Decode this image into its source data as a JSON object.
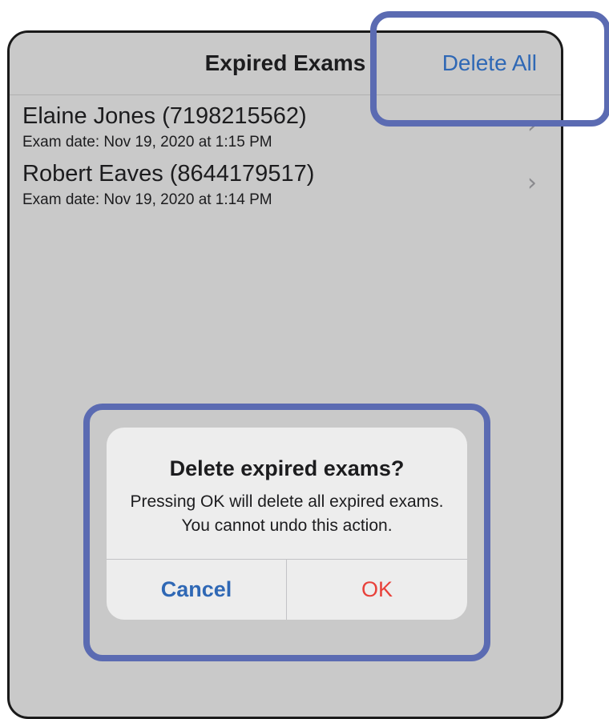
{
  "navbar": {
    "title": "Expired Exams",
    "action_label": "Delete All"
  },
  "exams": [
    {
      "name": "Elaine Jones (7198215562)",
      "date": "Exam date: Nov 19, 2020 at 1:15 PM"
    },
    {
      "name": "Robert Eaves (8644179517)",
      "date": "Exam date: Nov 19, 2020 at 1:14 PM"
    }
  ],
  "dialog": {
    "title": "Delete expired exams?",
    "message": "Pressing OK will delete all expired exams. You cannot undo this action.",
    "cancel_label": "Cancel",
    "ok_label": "OK"
  },
  "colors": {
    "accent": "#2f68b5",
    "destructive": "#e8413a",
    "highlight_border": "#5b6bb2",
    "screen_dimmed": "#c9c9c9"
  }
}
